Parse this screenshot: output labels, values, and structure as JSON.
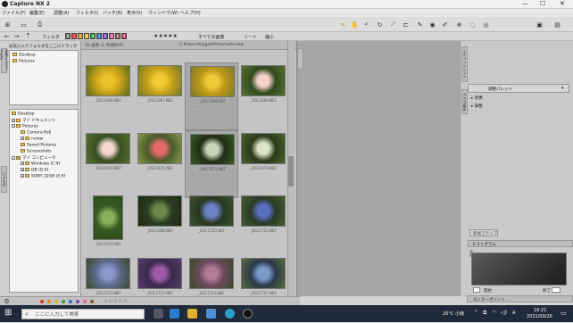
{
  "window": {
    "title": "Capture NX 2"
  },
  "menu": [
    "ファイル(F)",
    "編集(E)",
    "調整(A)",
    "フィルタ(I)",
    "バッチ(B)",
    "表示(V)",
    "ウィンドウ(W)",
    "ヘルプ(H)"
  ],
  "nav": {
    "filter_label": "フィルタ",
    "color_labels": [
      "0",
      "1",
      "2",
      "3",
      "4",
      "5",
      "6",
      "7",
      "8",
      "9"
    ],
    "rating_label": "★★★★★",
    "all_files_label": "すべての画像",
    "sort_label": "ソート",
    "size_label": "縮小"
  },
  "left_panel": {
    "favorites_tab": "お気に入りフォルダ",
    "favorites_hint": "お気に入りフォルダをここにドラッグ",
    "favorites": [
      "Desktop",
      "Pictures"
    ],
    "folders_tab": "フォルダ",
    "tree": [
      "Desktop",
      "マイ ドキュメント",
      "Pictures",
      "Camera Roll",
      "nview",
      "Saved Pictures",
      "Screenshots",
      "マイ コンピュータ",
      "Windows (C:¥)",
      "DB (D:¥)",
      "SONY 32GB (E:¥)"
    ]
  },
  "browser": {
    "header_left": "50 画像 (1 件選択中)",
    "header_right": "C:¥Users¥nagai¥Pictures¥nview",
    "thumbnails": [
      {
        "label": "_DSC1666.NEF",
        "colors": [
          "#c9a21a",
          "#e8c42a",
          "#5a6b1e"
        ]
      },
      {
        "label": "_DSC1667.NEF",
        "colors": [
          "#c9a21a",
          "#f0cc33",
          "#6f7a2a"
        ]
      },
      {
        "label": "_DSC1668.NEF",
        "colors": [
          "#bf9818",
          "#eecb3a",
          "#7a7a2a"
        ],
        "selected": true
      },
      {
        "label": "_DSC1669.NEF",
        "colors": [
          "#2f4a1e",
          "#f4d1c9",
          "#5a7030"
        ]
      },
      {
        "label": "_DSC1670.NEF",
        "colors": [
          "#364f22",
          "#f3d6cf",
          "#54702f"
        ]
      },
      {
        "label": "_DSC1671.NEF",
        "colors": [
          "#4a5a2a",
          "#e46a6a",
          "#87994a"
        ]
      },
      {
        "label": "_DSC1672.NEF",
        "colors": [
          "#1e2c14",
          "#c8d6b8",
          "#3c5a28"
        ],
        "selected": true
      },
      {
        "label": "_DSC1673.NEF",
        "colors": [
          "#2a3a1a",
          "#dbe2c8",
          "#4a6430"
        ]
      },
      {
        "label": "_DSC1674.NEF",
        "colors": [
          "#3a5a24",
          "#8ab05a",
          "#2a4a18"
        ]
      },
      {
        "label": "_DSC1688.NEF",
        "colors": [
          "#2a3c20",
          "#6a8a4a",
          "#1e2a14"
        ]
      },
      {
        "label": "_DSC1720.NEF",
        "colors": [
          "#283820",
          "#6a82c8",
          "#3a5030"
        ]
      },
      {
        "label": "_DSC1721.NEF",
        "colors": [
          "#2a3a24",
          "#5a6ec0",
          "#44602e"
        ]
      },
      {
        "label": "_DSC1722.NEF",
        "colors": [
          "#5a6a8c",
          "#8a96cc",
          "#3c4a2a"
        ]
      },
      {
        "label": "_DSC1723.NEF",
        "colors": [
          "#3a2a4a",
          "#a05aa8",
          "#5a3a6a"
        ]
      },
      {
        "label": "_DSC1724.NEF",
        "colors": [
          "#6a4a5a",
          "#b47a9a",
          "#3a4a2a"
        ]
      },
      {
        "label": "_DSC1725.NEF",
        "colors": [
          "#2a3a4a",
          "#7a9aca",
          "#5a6a3a"
        ]
      }
    ],
    "selected_label": "_DSC1668.NEF",
    "selected_label2": "_DSC1672.NEF"
  },
  "right_panel": {
    "tab_editlist": "エディットリスト",
    "tab_camera": "カメラ設定",
    "preset": "調整パレット",
    "items": [
      "現像",
      "調整"
    ],
    "new_step": "新規ステップ",
    "histogram_label": "ヒストグラム",
    "histo_side": "全体",
    "start_label": "開始",
    "end_label": "終了",
    "monitor_label": "モニターポイント"
  },
  "taskbar": {
    "search_placeholder": "ここに入力して検索",
    "weather": "20°C 小雨",
    "time": "16:21",
    "date": "2021/09/26",
    "lang": "A"
  }
}
